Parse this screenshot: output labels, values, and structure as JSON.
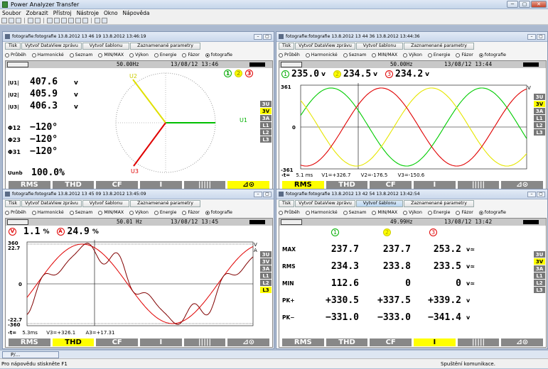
{
  "app": {
    "title": "Power Analyzer Transfer",
    "controls": [
      "─",
      "▢",
      "✕"
    ]
  },
  "menu": [
    "Soubor",
    "Zobrazit",
    "Přístroj",
    "Nástroje",
    "Okno",
    "Nápověda"
  ],
  "win1": {
    "title": "fotografie:fotografie 13.8.2012 13 46 19 13.8.2012 13:46:19",
    "buttons": [
      "Tisk",
      "Vytvoř DataView zprávu",
      "Vytvoř šablonu",
      "Zaznamenané parametry"
    ],
    "radios": [
      "Průběh",
      "Harmonické",
      "Seznam",
      "MIN/MAX",
      "Výkon",
      "Energie",
      "Fázor",
      "fotografie"
    ],
    "freq": "50.00Hz",
    "datetime": "13/08/12 13:46",
    "badges": [
      "1",
      "2",
      "3"
    ],
    "u_labels": [
      "|U1|",
      "|U2|",
      "|U3|"
    ],
    "u_values": [
      "407.6",
      "405.9",
      "406.3"
    ],
    "unit": "v",
    "phi_labels": [
      "Φ12",
      "Φ23",
      "Φ31"
    ],
    "phi_values": [
      "−120°",
      "−120°",
      "−120°"
    ],
    "unb_label": "Uunb",
    "unb_value": "100.0%",
    "vec_labels": [
      "U2",
      "U1",
      "U3"
    ],
    "side": [
      "3U",
      "3V",
      "3A",
      "L1",
      "L2",
      "L3"
    ],
    "tabs": [
      "RMS",
      "THD",
      "CF",
      "I",
      "|||||",
      "⊿⊙"
    ]
  },
  "win2": {
    "title": "fotografie:fotografie 13.8.2012 13 44 36 13.8.2012 13:44:36",
    "buttons": [
      "Tisk",
      "Vytvoř DataView zprávu",
      "Vytvoř šablonu",
      "Zaznamenané parametry"
    ],
    "radios": [
      "Průběh",
      "Harmonické",
      "Seznam",
      "MIN/MAX",
      "Výkon",
      "Energie",
      "Fázor",
      "fotografie"
    ],
    "freq": "50.00Hz",
    "datetime": "13/08/12 13:44",
    "readings": [
      "1",
      "235.0",
      "v",
      "2",
      "234.5",
      "v",
      "3",
      "234.2",
      "v"
    ],
    "ymax": "361",
    "yzero": "0",
    "ymin": "-361",
    "unit": "V",
    "cursor_time": "5.1 ms",
    "cursor_vals": [
      "V1=+326.7",
      "V2=-176.5",
      "V3=-150.6"
    ],
    "side": [
      "3U",
      "3V",
      "3A",
      "L1",
      "L2",
      "L3"
    ],
    "tabs": [
      "RMS",
      "THD",
      "CF",
      "I",
      "|||||",
      "⊿⊙"
    ]
  },
  "win3": {
    "title": "fotografie:fotografie 13.8.2012 13 45 09 13.8.2012 13:45:09",
    "buttons": [
      "Tisk",
      "Vytvoř DataView zprávu",
      "Vytvoř šablonu",
      "Zaznamenané parametry"
    ],
    "radios": [
      "Průběh",
      "Harmonické",
      "Seznam",
      "MIN/MAX",
      "Výkon",
      "Energie",
      "Fázor",
      "fotografie"
    ],
    "freq": "50.01 Hz",
    "datetime": "13/08/12 13:45",
    "thd_v_badge": "V",
    "thd_v": "1.1",
    "thd_v_unit": "%",
    "thd_a_badge": "A",
    "thd_a": "24.9",
    "thd_a_unit": "%",
    "ytop1": "360",
    "ytop2": "22.7",
    "yzero": "0",
    "ybot1": "-22.7",
    "ybot2": "-360",
    "unit_v": "V",
    "unit_a": "A",
    "cursor_time": "5.3ms",
    "cursor_vals": [
      "V3=+326.1",
      "A3=+17.31"
    ],
    "side": [
      "3U",
      "3V",
      "3A",
      "L1",
      "L2",
      "L3"
    ],
    "tabs": [
      "RMS",
      "THD",
      "CF",
      "I",
      "|||||",
      "⊿⊙"
    ]
  },
  "win4": {
    "title": "fotografie:fotografie 13.8.2012 13 42 54 13.8.2012 13:42:54",
    "buttons": [
      "Tisk",
      "Vytvoř DataView zprávu",
      "Vytvoř šablonu",
      "Zaznamenané parametry"
    ],
    "radios": [
      "Průběh",
      "Harmonické",
      "Seznam",
      "MIN/MAX",
      "Výkon",
      "Energie",
      "Fázor",
      "fotografie"
    ],
    "freq": "49.99Hz",
    "datetime": "13/08/12 13:42",
    "cols": [
      "1",
      "2",
      "3"
    ],
    "rows": [
      {
        "label": "MAX",
        "v": [
          "237.7",
          "237.7",
          "253.2"
        ],
        "u": "v≃"
      },
      {
        "label": "RMS",
        "v": [
          "234.3",
          "233.8",
          "233.5"
        ],
        "u": "v≃"
      },
      {
        "label": "MIN",
        "v": [
          "112.6",
          "0",
          "0"
        ],
        "u": "v≃"
      },
      {
        "label": "PK+",
        "v": [
          "+330.5",
          "+337.5",
          "+339.2"
        ],
        "u": "v"
      },
      {
        "label": "PK−",
        "v": [
          "−331.0",
          "−333.0",
          "−341.4"
        ],
        "u": "v"
      }
    ],
    "side": [
      "3U",
      "3V",
      "3A",
      "L1",
      "L2",
      "L3"
    ],
    "tabs": [
      "RMS",
      "THD",
      "CF",
      "I",
      "|||||",
      "⊿⊙"
    ]
  },
  "taskbar": {
    "item": "P/..."
  },
  "status": {
    "left": "Pro nápovědu stiskněte F1",
    "right": "Spuštění komunikace."
  },
  "colors": {
    "phase1": "#00cc00",
    "phase2": "#e6e600",
    "phase3": "#e00000",
    "sel": "#ffff00"
  }
}
